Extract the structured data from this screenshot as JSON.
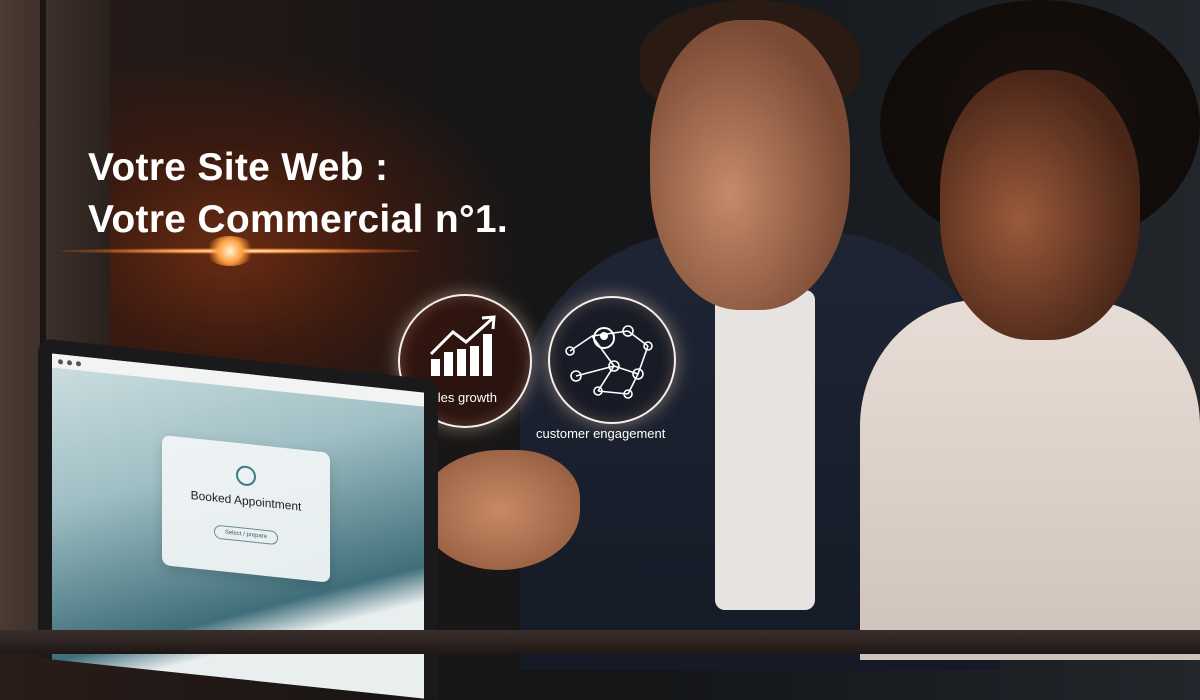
{
  "headline": {
    "line1": "Votre Site Web :",
    "line2": "Votre Commercial n°1."
  },
  "badges": [
    {
      "label": "sales growth",
      "icon": "bar-chart-growth-icon"
    },
    {
      "label": "customer engagement",
      "icon": "network-user-icon"
    }
  ],
  "laptop_screen": {
    "card_title": "Booked Appointment",
    "card_button": "Select / prepare"
  }
}
